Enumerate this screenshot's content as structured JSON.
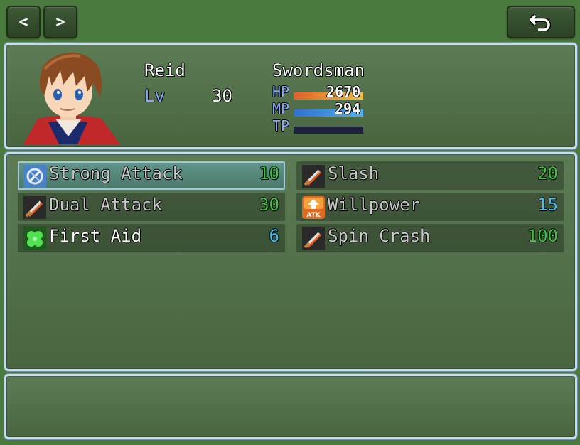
{
  "nav": {
    "prev_label": "<",
    "next_label": ">",
    "back_icon": "return-arrow-icon"
  },
  "actor": {
    "name": "Reid",
    "class": "Swordsman",
    "level_label": "Lv",
    "level": "30",
    "hp_label": "HP",
    "hp": "2670",
    "hp_fraction": 1.0,
    "mp_label": "MP",
    "mp": "294",
    "mp_fraction": 1.0,
    "tp_label": "TP",
    "tp_fraction": 0.0
  },
  "skills": [
    {
      "name": "Strong Attack",
      "cost": "10",
      "icon": "strong-attack-icon",
      "selected": true
    },
    {
      "name": "Slash",
      "cost": "20",
      "icon": "sword-icon"
    },
    {
      "name": "Dual Attack",
      "cost": "30",
      "icon": "sword-icon"
    },
    {
      "name": "Willpower",
      "cost": "15",
      "icon": "atk-up-icon"
    },
    {
      "name": "First Aid",
      "cost": "6",
      "icon": "clover-icon"
    },
    {
      "name": "Spin Crash",
      "cost": "100",
      "icon": "sword-icon"
    }
  ],
  "colors": {
    "hp_gauge": "#e0802a",
    "mp_gauge": "#3a8ae0",
    "tp_cost": "#40c040",
    "mp_cost": "#40c0f0",
    "system": "#84aaff"
  },
  "help": {
    "text": ""
  }
}
